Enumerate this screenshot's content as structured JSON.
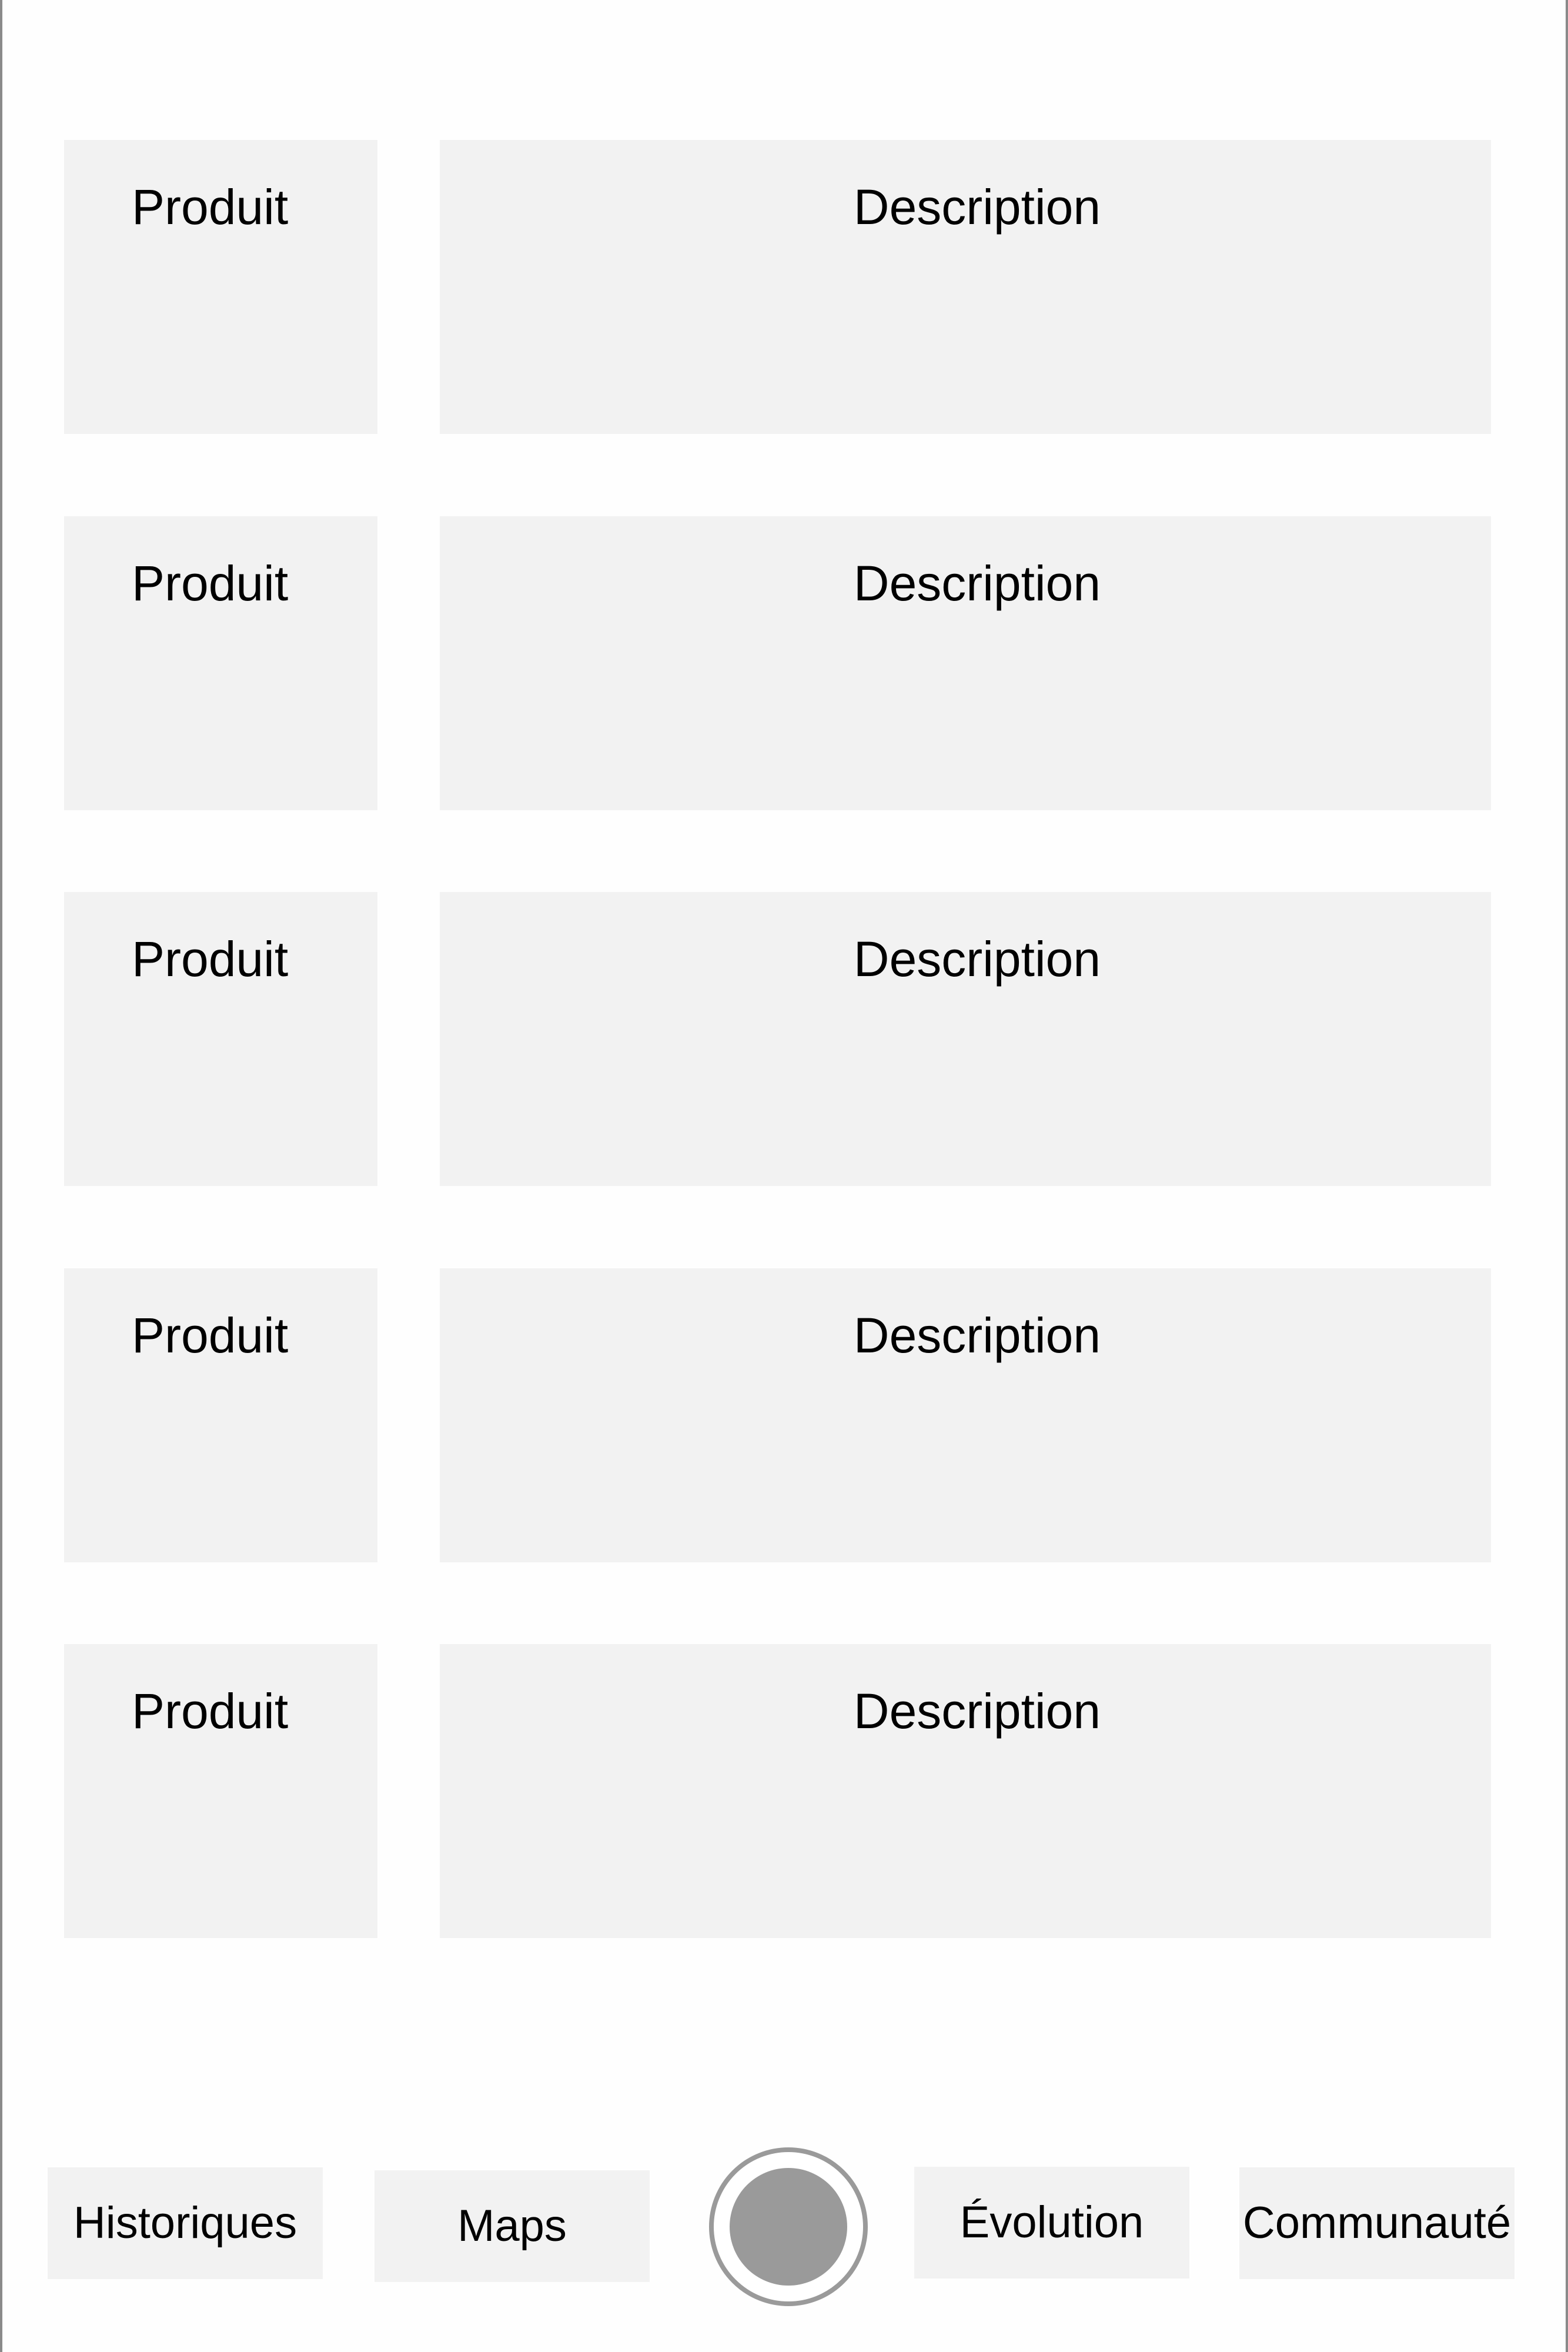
{
  "products": [
    {
      "product_label": "Produit",
      "description_label": "Description"
    },
    {
      "product_label": "Produit",
      "description_label": "Description"
    },
    {
      "product_label": "Produit",
      "description_label": "Description"
    },
    {
      "product_label": "Produit",
      "description_label": "Description"
    },
    {
      "product_label": "Produit",
      "description_label": "Description"
    }
  ],
  "nav": {
    "historiques_label": "Historiques",
    "maps_label": "Maps",
    "record_icon": "record-circle-icon",
    "evolution_label": "Évolution",
    "communaute_label": "Communauté"
  },
  "colors": {
    "cell_background": "#f2f2f2",
    "record_gray": "#9a9a9a",
    "frame_border": "#8a8a8a"
  }
}
